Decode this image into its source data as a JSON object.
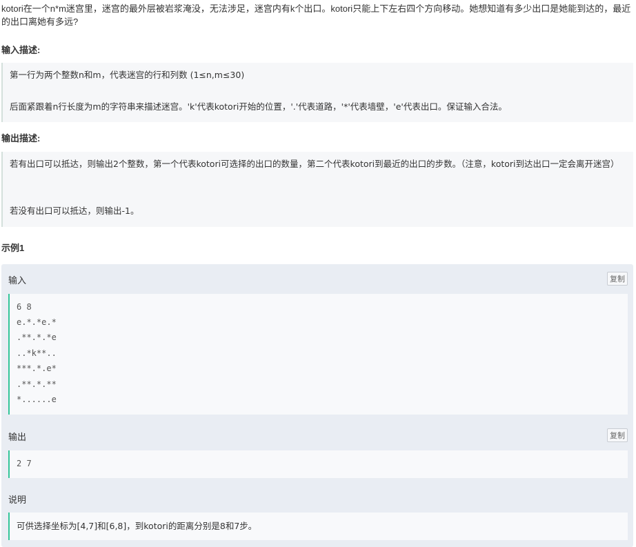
{
  "problem": {
    "intro": "kotori在一个n*m迷宫里，迷宫的最外层被岩浆淹没，无法涉足，迷宫内有k个出口。kotori只能上下左右四个方向移动。她想知道有多少出口是她能到达的，最近的出口离她有多远?"
  },
  "input_section": {
    "title": "输入描述:",
    "para1": "第一行为两个整数n和m，代表迷宫的行和列数 (1≤n,m≤30)",
    "para2": "后面紧跟着n行长度为m的字符串来描述迷宫。'k'代表kotori开始的位置，'.'代表道路，'*'代表墙壁，'e'代表出口。保证输入合法。"
  },
  "output_section": {
    "title": "输出描述:",
    "para1": "若有出口可以抵达，则输出2个整数，第一个代表kotori可选择的出口的数量，第二个代表kotori到最近的出口的步数。（注意，kotori到达出口一定会离开迷宫）",
    "para2": "若没有出口可以抵达，则输出-1。"
  },
  "example": {
    "title": "示例1",
    "input_label": "输入",
    "copy_label": "复制",
    "input_lines": [
      "6 8",
      "e.*.*e.*",
      ".**.*.*e",
      "..*k**..",
      "***.*.e*",
      ".**.*.**",
      "*......e"
    ],
    "output_label": "输出",
    "output_lines": [
      "2 7"
    ],
    "explain_label": "说明",
    "explain_text": "可供选择坐标为[4,7]和[6,8]，到kotori的距离分别是8和7步。"
  }
}
